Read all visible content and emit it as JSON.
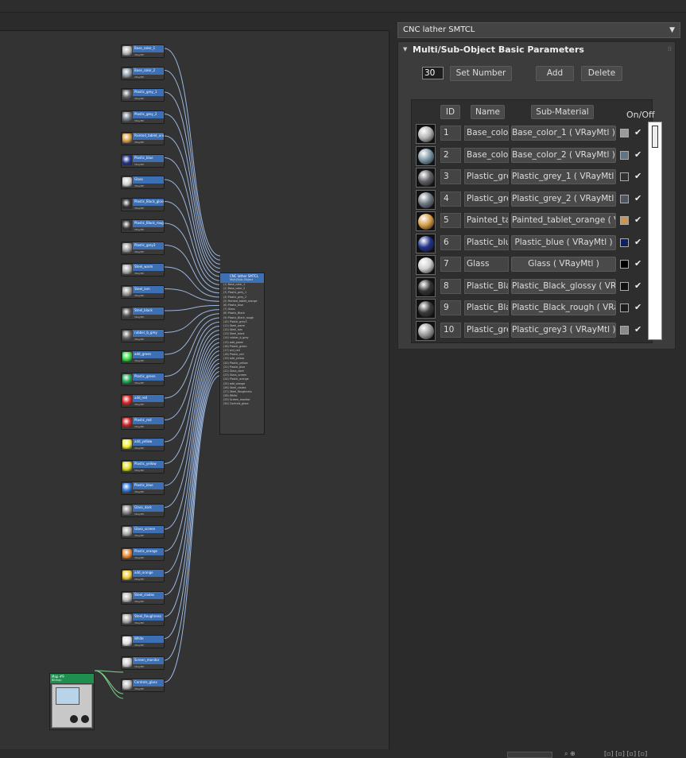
{
  "material_selector": {
    "value": "CNC lather SMTCL",
    "arrow_icon": "dropdown-arrow-icon"
  },
  "rollout": {
    "title": "Multi/Sub-Object Basic Parameters",
    "count_value": "30",
    "set_number_label": "Set Number",
    "add_label": "Add",
    "delete_label": "Delete"
  },
  "table": {
    "col_id": "ID",
    "col_name": "Name",
    "col_sub": "Sub-Material",
    "col_onoff": "On/Off",
    "rows": [
      {
        "id": "1",
        "name": "Base_color",
        "sub": "Base_color_1  ( VRayMtl )",
        "color": "#9a9a9a",
        "sphere": "#b5b5b5"
      },
      {
        "id": "2",
        "name": "Base_color",
        "sub": "Base_color_2  ( VRayMtl )",
        "color": "#5d7586",
        "sphere": "#7e98a8"
      },
      {
        "id": "3",
        "name": "Plastic_gre",
        "sub": "Plastic_grey_1  ( VRayMtl )",
        "color": "#303036",
        "sphere": "#606066"
      },
      {
        "id": "4",
        "name": "Plastic_gre",
        "sub": "Plastic_grey_2  ( VRayMtl )",
        "color": "#4c5560",
        "sphere": "#707a85"
      },
      {
        "id": "5",
        "name": "Painted_ta",
        "sub": "Painted_tablet_orange  ( V",
        "color": "#c8964e",
        "sphere": "#d8a04a"
      },
      {
        "id": "6",
        "name": "Plastic_blu",
        "sub": "Plastic_blue  ( VRayMtl )",
        "color": "#0d1f66",
        "sphere": "#22338a"
      },
      {
        "id": "7",
        "name": "Glass",
        "sub": "Glass  ( VRayMtl )",
        "color": "#000000",
        "sphere": "#d0d0d0"
      },
      {
        "id": "8",
        "name": "Plastic_Bla",
        "sub": "Plastic_Black_glossy  ( VRa",
        "color": "#111111",
        "sphere": "#333333"
      },
      {
        "id": "9",
        "name": "Plastic_Bla",
        "sub": "Plastic_Black_rough  ( VRay",
        "color": "#1c1c1c",
        "sphere": "#3a3a3a"
      },
      {
        "id": "10",
        "name": "Plastic_gre",
        "sub": "Plastic_grey3  ( VRayMtl )",
        "color": "#8a8a8a",
        "sphere": "#9c9c9c"
      }
    ]
  },
  "node_editor": {
    "multi_node": {
      "title": "CNC lather SMTCL",
      "subtitle": "Multi/Sub-Object",
      "slots": [
        "(1) Base_color_1",
        "(2) Base_color_2",
        "(3) Plastic_grey_1",
        "(4) Plastic_grey_2",
        "(5) Painted_tablet_orange",
        "(6) Plastic_blue",
        "(7) Glass",
        "(8) Plastic_Black",
        "(9) Plastic_Black_rough",
        "(10) Plastic_grey3",
        "(11) Steel_warm",
        "(12) Steel_lam",
        "(13) Steel_black",
        "(14) rubber_b_grey",
        "(15) add_green",
        "(16) Plastic_green",
        "(17) sml_red",
        "(18) Plastic_red",
        "(19) add_yellow",
        "(20) Plastic_yellow",
        "(21) Plastic_blue",
        "(22) Glass_dark",
        "(23) Glass_screen",
        "(24) Plastic_orange",
        "(25) add_orange",
        "(26) Steel_clades",
        "(27) Steel_Roughness",
        "(28) White",
        "(29) Screen_monitor",
        "(30) Controls_glass"
      ]
    },
    "bitmap_node": {
      "title": "Map #9",
      "subtitle": "Bitmap"
    },
    "mat_nodes": [
      {
        "name": "Base_color_1",
        "type": "VRayMtl",
        "swatch": "#b5b5b5"
      },
      {
        "name": "Base_color_2",
        "type": "VRayMtl",
        "swatch": "#8a9aa8"
      },
      {
        "name": "Plastic_grey_1",
        "type": "VRayMtl",
        "swatch": "#606066"
      },
      {
        "name": "Plastic_grey_2",
        "type": "VRayMtl",
        "swatch": "#707a85"
      },
      {
        "name": "Painted_tablet_orange",
        "type": "VRayMtl",
        "swatch": "#d8a04a"
      },
      {
        "name": "Plastic_blue",
        "type": "VRayMtl",
        "swatch": "#22338a"
      },
      {
        "name": "Glass",
        "type": "VRayMtl",
        "swatch": "#d0d0d0"
      },
      {
        "name": "Plastic_Black_glossy",
        "type": "VRayMtl",
        "swatch": "#333333"
      },
      {
        "name": "Plastic_Black_rough",
        "type": "VRayMtl",
        "swatch": "#3a3a3a"
      },
      {
        "name": "Plastic_grey3",
        "type": "VRayMtl",
        "swatch": "#9c9c9c"
      },
      {
        "name": "Steel_warm",
        "type": "VRayMtl",
        "swatch": "#aaaaaa"
      },
      {
        "name": "Steel_lam",
        "type": "VRayMtl",
        "swatch": "#999999"
      },
      {
        "name": "Steel_black",
        "type": "VRayMtl",
        "swatch": "#555555"
      },
      {
        "name": "rubber_b_grey",
        "type": "VRayMtl",
        "swatch": "#666666"
      },
      {
        "name": "add_green",
        "type": "VRayMtl",
        "swatch": "#33dd44"
      },
      {
        "name": "Plastic_green",
        "type": "VRayMtl",
        "swatch": "#22aa55"
      },
      {
        "name": "add_red",
        "type": "VRayMtl",
        "swatch": "#dd2222"
      },
      {
        "name": "Plastic_red",
        "type": "VRayMtl",
        "swatch": "#cc2222"
      },
      {
        "name": "add_yellow",
        "type": "VRayMtl",
        "swatch": "#eeee33"
      },
      {
        "name": "Plastic_yellow",
        "type": "VRayMtl",
        "swatch": "#dddd22"
      },
      {
        "name": "Plastic_blue",
        "type": "VRayMtl",
        "swatch": "#3377dd"
      },
      {
        "name": "Glass_dark",
        "type": "VRayMtl",
        "swatch": "#888888"
      },
      {
        "name": "Glass_screen",
        "type": "VRayMtl",
        "swatch": "#aaaaaa"
      },
      {
        "name": "Plastic_orange",
        "type": "VRayMtl",
        "swatch": "#ee8833"
      },
      {
        "name": "add_orange",
        "type": "VRayMtl",
        "swatch": "#eecc33"
      },
      {
        "name": "Steel_clades",
        "type": "VRayMtl",
        "swatch": "#bbbbbb"
      },
      {
        "name": "Steel_Roughness",
        "type": "VRayMtl",
        "swatch": "#aaaaaa"
      },
      {
        "name": "White",
        "type": "VRayMtl",
        "swatch": "#dddddd"
      },
      {
        "name": "Screen_monitor",
        "type": "VRayMtl",
        "swatch": "#cccccc"
      },
      {
        "name": "Controls_glass",
        "type": "VRayMtl",
        "swatch": "#bbbbbb"
      }
    ]
  }
}
